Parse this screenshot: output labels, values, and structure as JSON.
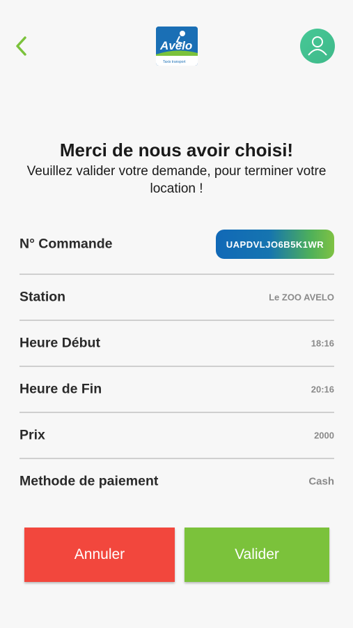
{
  "header": {
    "logo_text": "Avelo",
    "logo_tagline": "Taxis transport",
    "back_icon": "chevron-left-icon",
    "profile_icon": "user-icon"
  },
  "intro": {
    "title": "Merci de nous avoir choisi!",
    "subtitle": "Veuillez valider votre demande, pour  terminer votre location !"
  },
  "details": [
    {
      "label": "N° Commande",
      "value": "UAPDVLJO6B5K1WR"
    },
    {
      "label": "Station",
      "value": "Le ZOO AVELO"
    },
    {
      "label": "Heure Début",
      "value": "18:16"
    },
    {
      "label": "Heure de Fin",
      "value": "20:16"
    },
    {
      "label": "Prix",
      "value": "2000"
    },
    {
      "label": "Methode de paiement",
      "value": "Cash"
    }
  ],
  "actions": {
    "cancel_label": "Annuler",
    "validate_label": "Valider"
  },
  "colors": {
    "accent_green": "#7bc23b",
    "cancel_red": "#f2473d",
    "brand_blue": "#1169b7",
    "avatar_green": "#46c896"
  }
}
